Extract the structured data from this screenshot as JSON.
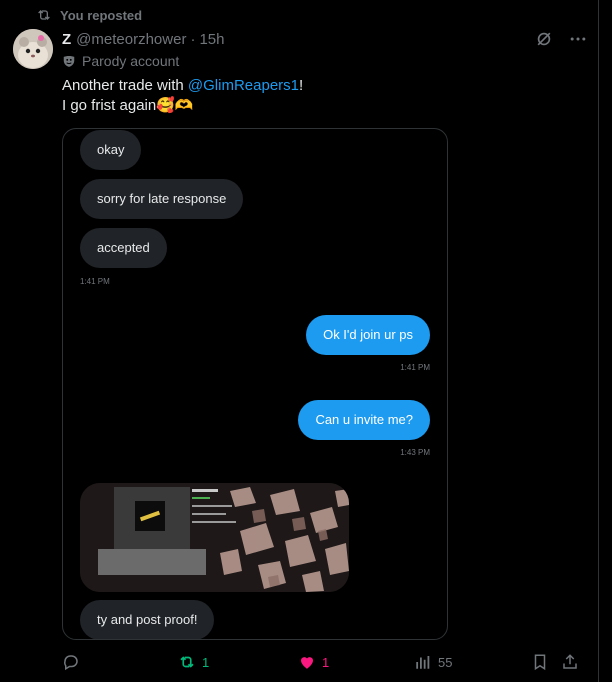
{
  "repost": {
    "label": "You reposted"
  },
  "post": {
    "display_name": "Z",
    "handle": "@meteorzhower",
    "separator": "·",
    "time": "15h",
    "label": "Parody account",
    "text_prefix": "Another trade with ",
    "mention": "@GlimReapers1",
    "text_suffix": "!",
    "line2": "I go frist again",
    "line2_emojis": "🥰🫶"
  },
  "chat": {
    "messages": [
      {
        "side": "received",
        "text": "okay"
      },
      {
        "side": "received",
        "text": "sorry for late response"
      },
      {
        "side": "received",
        "text": "accepted"
      },
      {
        "side": "timestamp",
        "text": "1:41 PM"
      },
      {
        "side": "sent",
        "text": "Ok I'd join ur ps"
      },
      {
        "side": "timestamp",
        "text": "1:41 PM"
      },
      {
        "side": "sent",
        "text": "Can u invite me?"
      },
      {
        "side": "timestamp",
        "text": "1:43 PM"
      },
      {
        "side": "received",
        "type": "image"
      },
      {
        "side": "received",
        "text": "ty and post proof!"
      }
    ]
  },
  "actions": {
    "reply": {
      "icon": "reply-icon"
    },
    "repost": {
      "count": "1",
      "active": true,
      "color": "#00ba7c"
    },
    "like": {
      "count": "1",
      "active": true,
      "color": "#f91880"
    },
    "views": {
      "count": "55"
    },
    "bookmark": {
      "icon": "bookmark-icon"
    },
    "share": {
      "icon": "share-icon"
    }
  },
  "colors": {
    "background": "#000000",
    "text": "#e7e9ea",
    "muted": "#71767b",
    "accent": "#1d9bf0"
  }
}
